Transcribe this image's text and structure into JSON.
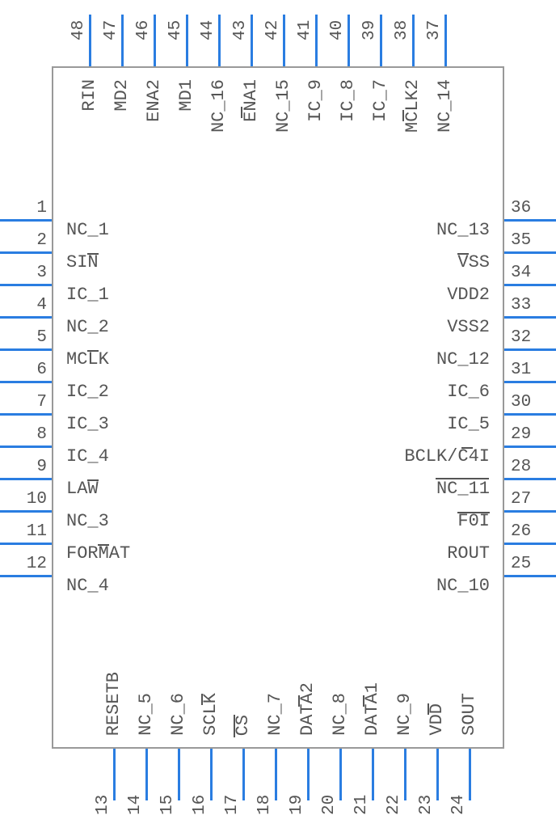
{
  "chip": {
    "left": [
      {
        "num": "1",
        "label": "NC_1"
      },
      {
        "num": "2",
        "label": "SIN"
      },
      {
        "num": "3",
        "label": "IC_1"
      },
      {
        "num": "4",
        "label": "NC_2"
      },
      {
        "num": "5",
        "label": "MCLK"
      },
      {
        "num": "6",
        "label": "IC_2"
      },
      {
        "num": "7",
        "label": "IC_3"
      },
      {
        "num": "8",
        "label": "IC_4"
      },
      {
        "num": "9",
        "label": "LAW"
      },
      {
        "num": "10",
        "label": "NC_3"
      },
      {
        "num": "11",
        "label": "FORMAT"
      },
      {
        "num": "12",
        "label": "NC_4"
      }
    ],
    "bottom": [
      {
        "num": "13",
        "label": "RESETB"
      },
      {
        "num": "14",
        "label": "NC_5"
      },
      {
        "num": "15",
        "label": "NC_6"
      },
      {
        "num": "16",
        "label": "SCLK"
      },
      {
        "num": "17",
        "label": "CS"
      },
      {
        "num": "18",
        "label": "NC_7"
      },
      {
        "num": "19",
        "label": "DATA2"
      },
      {
        "num": "20",
        "label": "NC_8"
      },
      {
        "num": "21",
        "label": "DATA1"
      },
      {
        "num": "22",
        "label": "NC_9"
      },
      {
        "num": "23",
        "label": "VDD"
      },
      {
        "num": "24",
        "label": "SOUT"
      }
    ],
    "right": [
      {
        "num": "36",
        "label": "NC_13"
      },
      {
        "num": "35",
        "label": "VSS"
      },
      {
        "num": "34",
        "label": "VDD2"
      },
      {
        "num": "33",
        "label": "VSS2"
      },
      {
        "num": "32",
        "label": "NC_12"
      },
      {
        "num": "31",
        "label": "IC_6"
      },
      {
        "num": "30",
        "label": "IC_5"
      },
      {
        "num": "29",
        "label": "BCLK/C4I"
      },
      {
        "num": "28",
        "label": "NC_11"
      },
      {
        "num": "27",
        "label": "F0I"
      },
      {
        "num": "26",
        "label": "ROUT"
      },
      {
        "num": "25",
        "label": "NC_10"
      }
    ],
    "top": [
      {
        "num": "48",
        "label": "RIN"
      },
      {
        "num": "47",
        "label": "MD2"
      },
      {
        "num": "46",
        "label": "ENA2"
      },
      {
        "num": "45",
        "label": "MD1"
      },
      {
        "num": "44",
        "label": "NC_16"
      },
      {
        "num": "43",
        "label": "ENA1"
      },
      {
        "num": "42",
        "label": "NC_15"
      },
      {
        "num": "41",
        "label": "IC_9"
      },
      {
        "num": "40",
        "label": "IC_8"
      },
      {
        "num": "39",
        "label": "IC_7"
      },
      {
        "num": "38",
        "label": "MCLK2"
      },
      {
        "num": "37",
        "label": "NC_14"
      }
    ]
  }
}
